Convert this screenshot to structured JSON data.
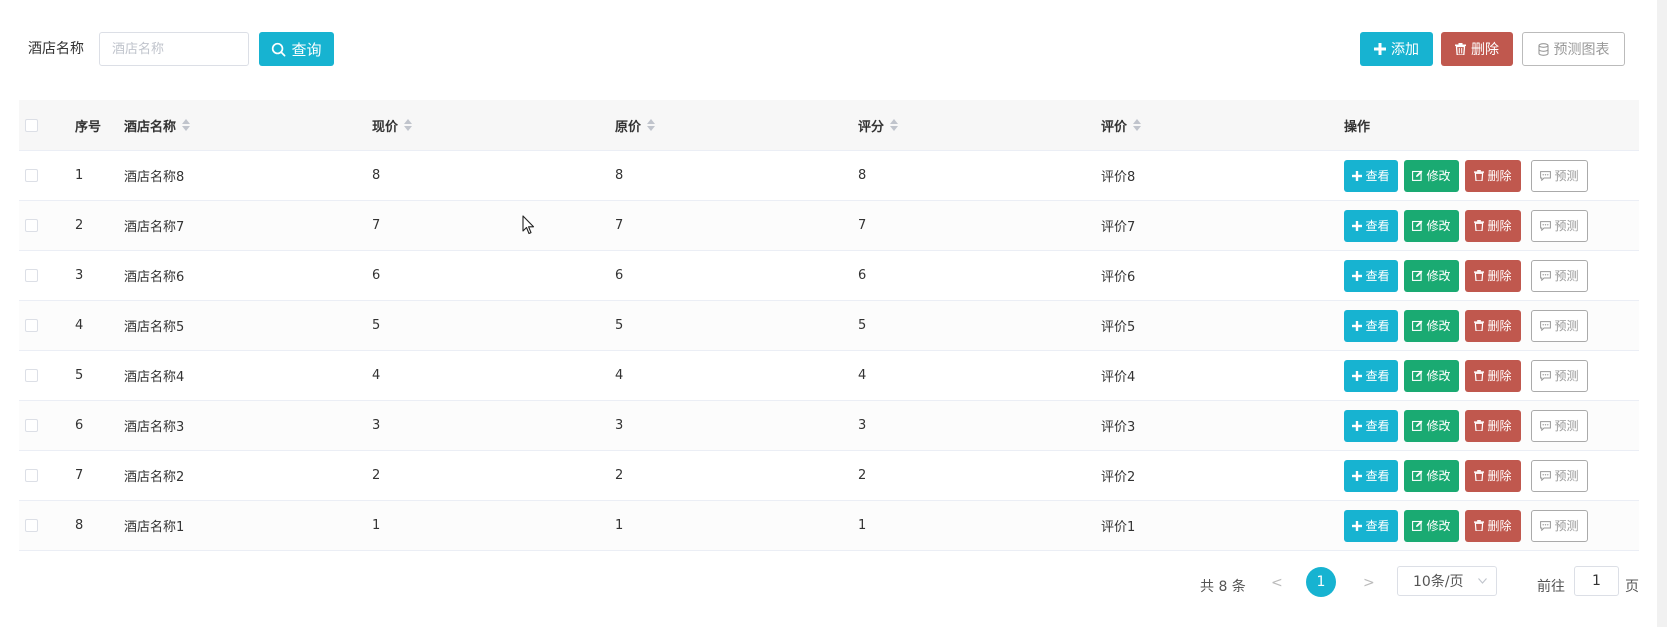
{
  "search": {
    "label": "酒店名称",
    "placeholder": "酒店名称",
    "query_label": "查询"
  },
  "toolbar": {
    "add_label": "添加",
    "delete_label": "删除",
    "chart_label": "预测图表"
  },
  "table": {
    "headers": {
      "index": "序号",
      "name": "酒店名称",
      "current_price": "现价",
      "original_price": "原价",
      "score": "评分",
      "review": "评价",
      "actions": "操作"
    },
    "row_actions": {
      "view": "查看",
      "edit": "修改",
      "delete": "删除",
      "predict": "预测"
    },
    "rows": [
      {
        "index": "1",
        "name": "酒店名称8",
        "current_price": "8",
        "original_price": "8",
        "score": "8",
        "review": "评价8"
      },
      {
        "index": "2",
        "name": "酒店名称7",
        "current_price": "7",
        "original_price": "7",
        "score": "7",
        "review": "评价7"
      },
      {
        "index": "3",
        "name": "酒店名称6",
        "current_price": "6",
        "original_price": "6",
        "score": "6",
        "review": "评价6"
      },
      {
        "index": "4",
        "name": "酒店名称5",
        "current_price": "5",
        "original_price": "5",
        "score": "5",
        "review": "评价5"
      },
      {
        "index": "5",
        "name": "酒店名称4",
        "current_price": "4",
        "original_price": "4",
        "score": "4",
        "review": "评价4"
      },
      {
        "index": "6",
        "name": "酒店名称3",
        "current_price": "3",
        "original_price": "3",
        "score": "3",
        "review": "评价3"
      },
      {
        "index": "7",
        "name": "酒店名称2",
        "current_price": "2",
        "original_price": "2",
        "score": "2",
        "review": "评价2"
      },
      {
        "index": "8",
        "name": "酒店名称1",
        "current_price": "1",
        "original_price": "1",
        "score": "1",
        "review": "评价1"
      }
    ]
  },
  "pagination": {
    "total": "共 8 条",
    "prev": "<",
    "current_page": "1",
    "next": ">",
    "page_size": "10条/页",
    "goto_prefix": "前往",
    "goto_value": "1",
    "goto_suffix": "页"
  },
  "colors": {
    "primary": "#17b3d1",
    "success": "#1aaa72",
    "danger": "#c0584e"
  }
}
